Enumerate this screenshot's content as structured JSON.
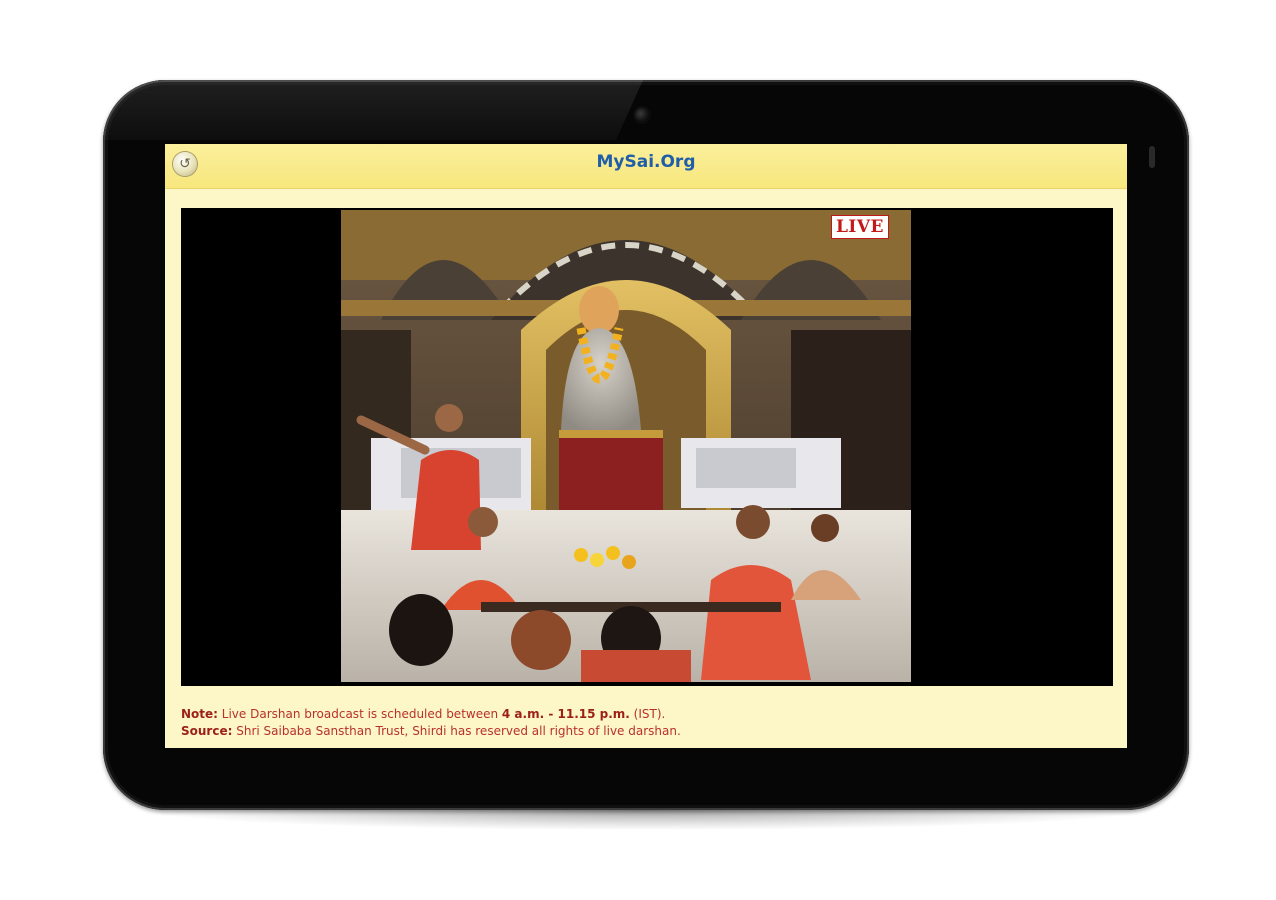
{
  "app": {
    "title": "MySai.Org",
    "back_icon": "back-arrow-icon"
  },
  "video": {
    "live_label": "LIVE"
  },
  "note": {
    "label": "Note:",
    "text_before": " Live Darshan broadcast is scheduled between ",
    "time_range": "4 a.m. - 11.15 p.m.",
    "text_after": " (IST)."
  },
  "source": {
    "label": "Source:",
    "text": " Shri Saibaba Sansthan Trust, Shirdi has reserved all rights of live darshan."
  },
  "colors": {
    "app_bar": "#f7e77d",
    "screen_bg": "#fdf6c6",
    "title": "#1f5ea8",
    "note_text": "#b8322a",
    "live_red": "#c21a1a",
    "bezel": "#060606"
  }
}
